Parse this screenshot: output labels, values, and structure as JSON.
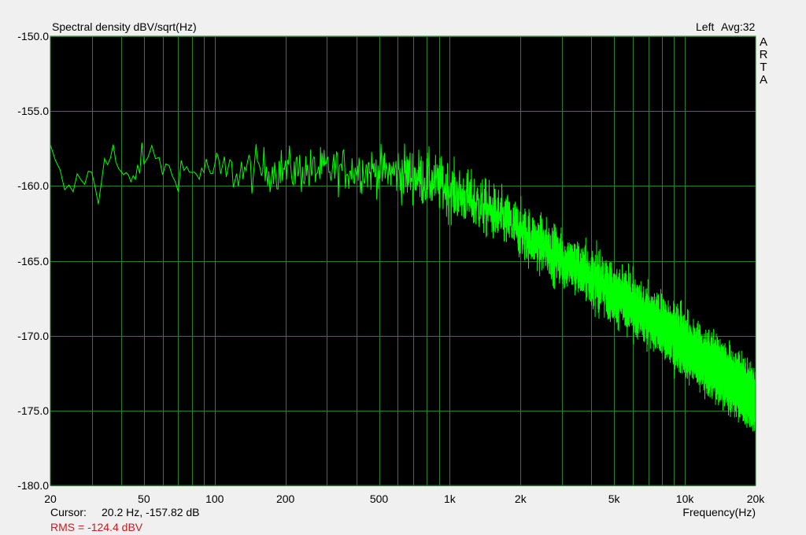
{
  "header": {
    "title": "Spectral density dBV/sqrt(Hz)",
    "channel": "Left",
    "average": "Avg:32",
    "brand": [
      "A",
      "R",
      "T",
      "A"
    ]
  },
  "footer": {
    "cursor_label": "Cursor:",
    "cursor_value": "20.2 Hz, -157.82 dB",
    "rms": "RMS = -124.4 dBV"
  },
  "colors": {
    "plot_background": "#000000",
    "grid": "#2e7d32",
    "trace": "#00ff00",
    "rms_text": "#c81e1e",
    "window_background": "#f0f0f0"
  },
  "chart_data": {
    "type": "line",
    "title": "Spectral density dBV/sqrt(Hz)",
    "xlabel": "Frequency(Hz)",
    "ylabel": "",
    "xscale": "log",
    "xlim": [
      20,
      20000
    ],
    "ylim": [
      -180,
      -150
    ],
    "grid": true,
    "x_ticks": [
      {
        "value": 20,
        "label": "20"
      },
      {
        "value": 50,
        "label": "50"
      },
      {
        "value": 100,
        "label": "100"
      },
      {
        "value": 200,
        "label": "200"
      },
      {
        "value": 500,
        "label": "500"
      },
      {
        "value": 1000,
        "label": "1k"
      },
      {
        "value": 2000,
        "label": "2k"
      },
      {
        "value": 5000,
        "label": "5k"
      },
      {
        "value": 10000,
        "label": "10k"
      },
      {
        "value": 20000,
        "label": "20k"
      }
    ],
    "y_ticks": [
      {
        "value": -150,
        "label": "-150.0"
      },
      {
        "value": -155,
        "label": "-155.0"
      },
      {
        "value": -160,
        "label": "-160.0"
      },
      {
        "value": -165,
        "label": "-165.0"
      },
      {
        "value": -170,
        "label": "-170.0"
      },
      {
        "value": -175,
        "label": "-175.0"
      },
      {
        "value": -180,
        "label": "-180.0"
      }
    ],
    "series": [
      {
        "x": [
          20,
          22,
          24,
          26,
          28,
          30,
          32,
          34,
          36,
          38,
          40,
          44,
          48,
          52,
          56,
          60,
          66,
          72,
          80,
          90,
          100,
          120,
          150,
          200,
          250,
          300,
          400,
          500,
          600,
          700,
          800,
          900,
          1000,
          1200,
          1500,
          2000,
          2500,
          3000,
          4000,
          5000,
          6000,
          7000,
          8000,
          10000,
          12000,
          15000,
          18000,
          20000
        ],
        "y": [
          -157.8,
          -159.5,
          -160.6,
          -159.6,
          -159.3,
          -159.5,
          -161.0,
          -158.0,
          -157.4,
          -158.3,
          -159.2,
          -160.0,
          -158.4,
          -158.2,
          -157.8,
          -158.6,
          -159.3,
          -158.8,
          -159.2,
          -158.9,
          -159.0,
          -159.1,
          -158.9,
          -158.9,
          -159.0,
          -158.9,
          -158.9,
          -159.0,
          -159.1,
          -159.3,
          -159.6,
          -159.9,
          -160.3,
          -160.9,
          -161.7,
          -163.0,
          -164.0,
          -164.9,
          -166.1,
          -167.2,
          -168.0,
          -168.8,
          -169.4,
          -170.6,
          -171.6,
          -172.7,
          -173.7,
          -174.2
        ]
      }
    ]
  }
}
